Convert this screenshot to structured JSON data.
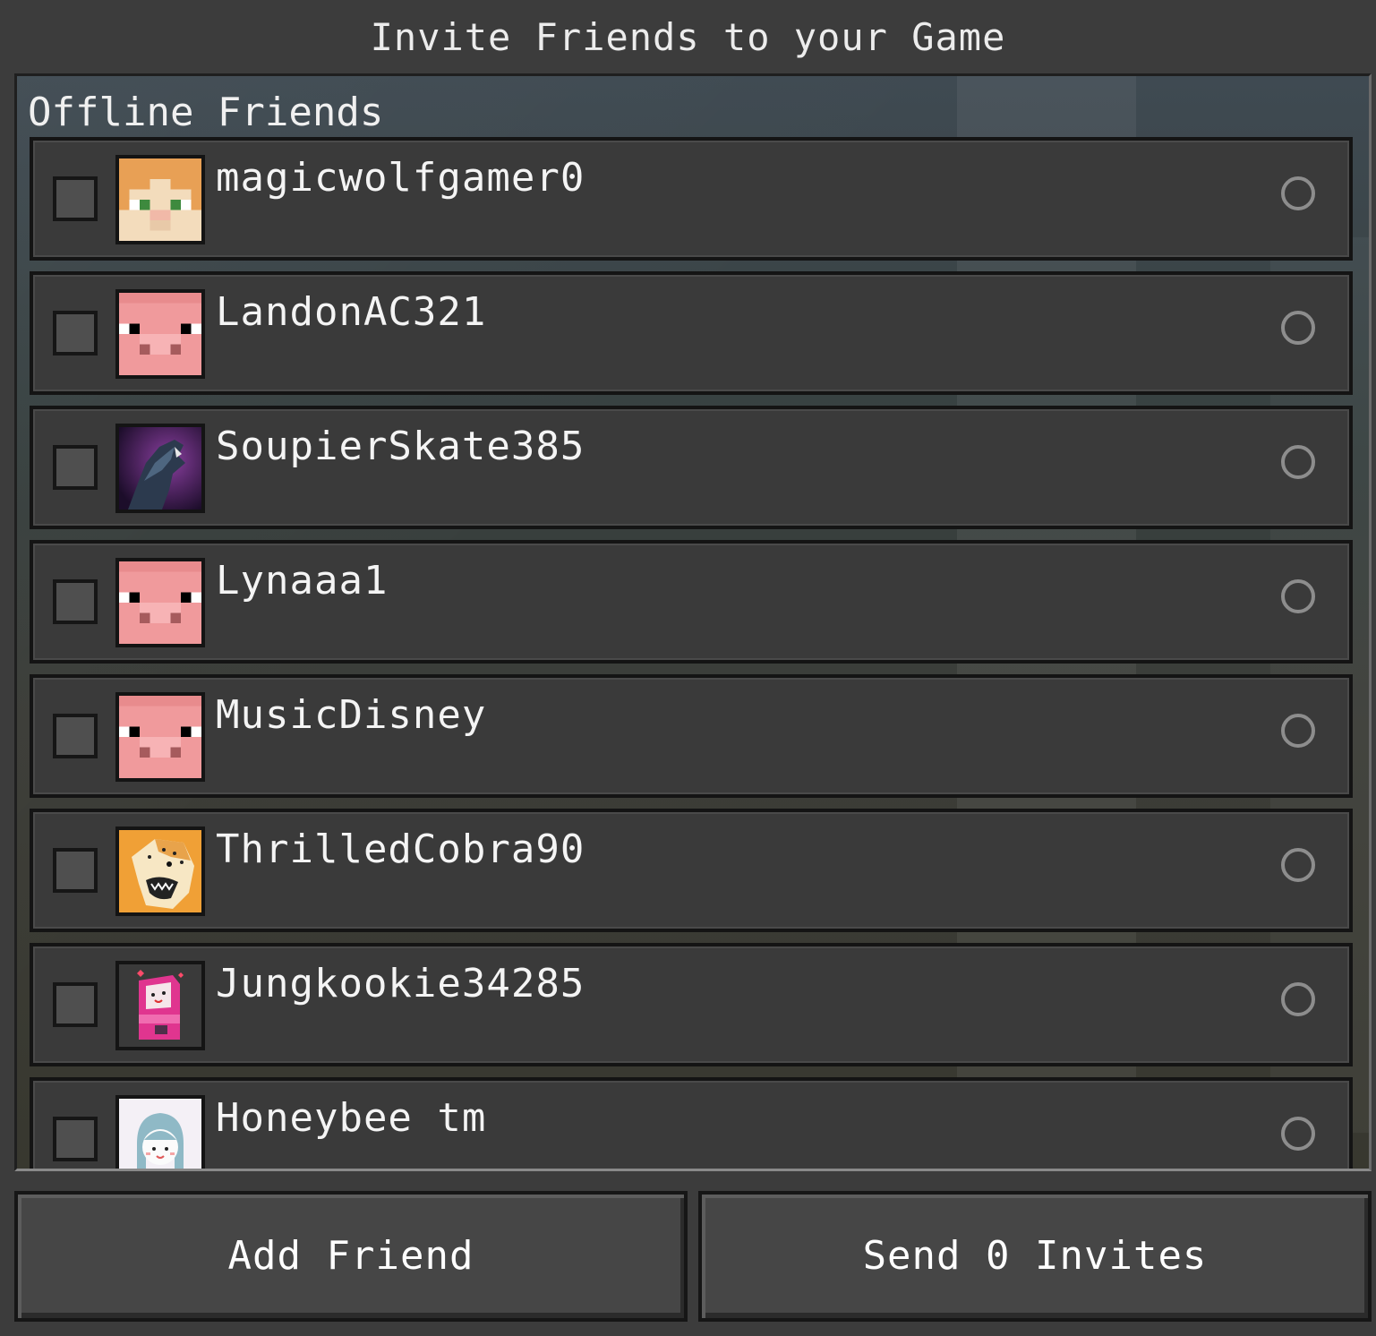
{
  "dialog": {
    "title": "Invite Friends to your Game"
  },
  "friends_section": {
    "label": "Offline Friends",
    "friends": [
      {
        "gamertag": "magicwolfgamer0",
        "avatar": "alex-skin-icon",
        "checked": false,
        "status": "offline"
      },
      {
        "gamertag": "LandonAC321",
        "avatar": "pig-face-icon",
        "checked": false,
        "status": "offline"
      },
      {
        "gamertag": "SoupierSkate385",
        "avatar": "werewolf-picture-icon",
        "checked": false,
        "status": "offline"
      },
      {
        "gamertag": "Lynaaa1",
        "avatar": "pig-face-icon",
        "checked": false,
        "status": "offline"
      },
      {
        "gamertag": "MusicDisney",
        "avatar": "pig-face-icon",
        "checked": false,
        "status": "offline"
      },
      {
        "gamertag": "ThrilledCobra90",
        "avatar": "cheetah-picture-icon",
        "checked": false,
        "status": "offline"
      },
      {
        "gamertag": "Jungkookie34285",
        "avatar": "arcade-cabinet-icon",
        "checked": false,
        "status": "offline"
      },
      {
        "gamertag": "Honeybee tm",
        "avatar": "anime-girl-icon",
        "checked": false,
        "status": "offline"
      }
    ]
  },
  "buttons": {
    "add_friend": "Add Friend",
    "send_invites": "Send 0 Invites"
  },
  "colors": {
    "background": "#3c3c3c",
    "row": "#3a3a3a",
    "border": "#141414",
    "checkbox": "#4f4f4f",
    "status_ring": "#8d8d8d"
  }
}
